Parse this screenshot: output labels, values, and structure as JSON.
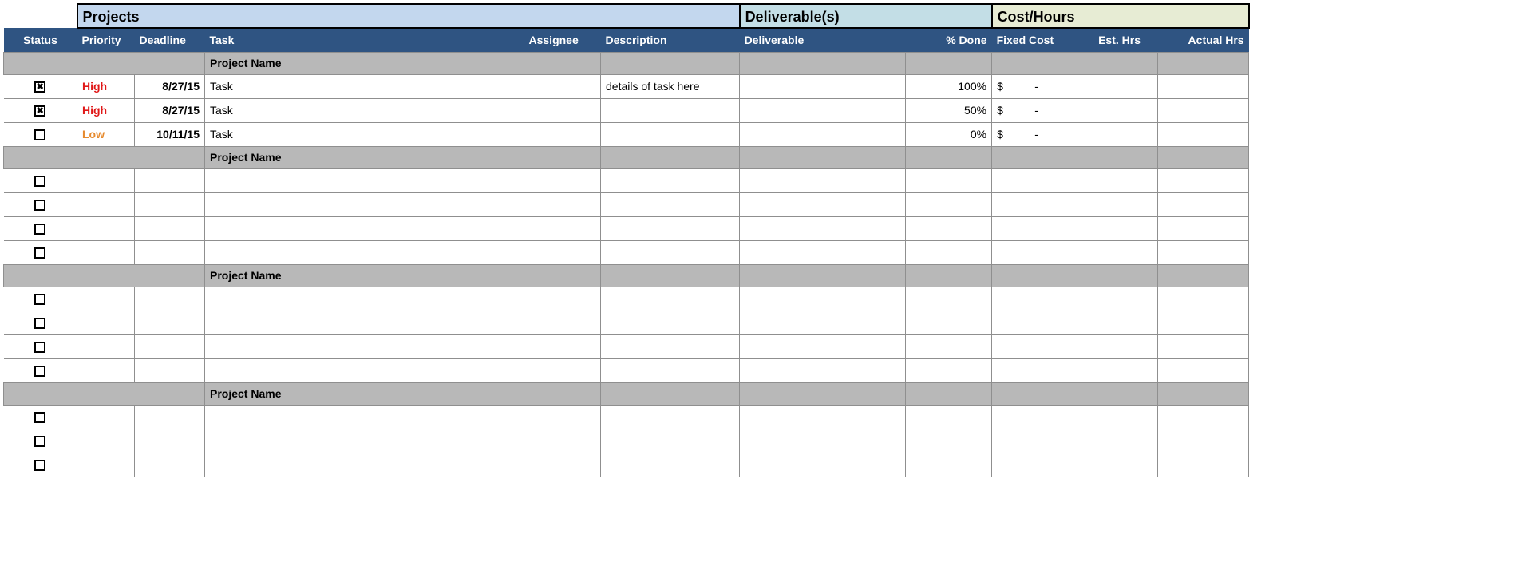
{
  "sections": {
    "projects": "Projects",
    "deliverables": "Deliverable(s)",
    "cost_hours": "Cost/Hours"
  },
  "columns": {
    "status": "Status",
    "priority": "Priority",
    "deadline": "Deadline",
    "task": "Task",
    "assignee": "Assignee",
    "description": "Description",
    "deliverable": "Deliverable",
    "pct_done": "% Done",
    "fixed_cost": "Fixed Cost",
    "est_hrs": "Est. Hrs",
    "actual_hrs": "Actual Hrs"
  },
  "groups": [
    {
      "name": "Project Name",
      "rows": [
        {
          "checked": true,
          "priority": "High",
          "priority_class": "prio-high",
          "deadline": "8/27/15",
          "task": "Task",
          "assignee": "",
          "description": "details of task here",
          "deliverable": "",
          "pct_done": "100%",
          "cost_sym": "$",
          "cost_val": "-",
          "est": "",
          "act": ""
        },
        {
          "checked": true,
          "priority": "High",
          "priority_class": "prio-high",
          "deadline": "8/27/15",
          "task": "Task",
          "assignee": "",
          "description": "",
          "deliverable": "",
          "pct_done": "50%",
          "cost_sym": "$",
          "cost_val": "-",
          "est": "",
          "act": ""
        },
        {
          "checked": false,
          "priority": "Low",
          "priority_class": "prio-low",
          "deadline": "10/11/15",
          "task": "Task",
          "assignee": "",
          "description": "",
          "deliverable": "",
          "pct_done": "0%",
          "cost_sym": "$",
          "cost_val": "-",
          "est": "",
          "act": ""
        }
      ]
    },
    {
      "name": "Project Name",
      "rows": [
        {
          "checked": false,
          "priority": "",
          "priority_class": "",
          "deadline": "",
          "task": "",
          "assignee": "",
          "description": "",
          "deliverable": "",
          "pct_done": "",
          "cost_sym": "",
          "cost_val": "",
          "est": "",
          "act": ""
        },
        {
          "checked": false,
          "priority": "",
          "priority_class": "",
          "deadline": "",
          "task": "",
          "assignee": "",
          "description": "",
          "deliverable": "",
          "pct_done": "",
          "cost_sym": "",
          "cost_val": "",
          "est": "",
          "act": ""
        },
        {
          "checked": false,
          "priority": "",
          "priority_class": "",
          "deadline": "",
          "task": "",
          "assignee": "",
          "description": "",
          "deliverable": "",
          "pct_done": "",
          "cost_sym": "",
          "cost_val": "",
          "est": "",
          "act": ""
        },
        {
          "checked": false,
          "priority": "",
          "priority_class": "",
          "deadline": "",
          "task": "",
          "assignee": "",
          "description": "",
          "deliverable": "",
          "pct_done": "",
          "cost_sym": "",
          "cost_val": "",
          "est": "",
          "act": ""
        }
      ]
    },
    {
      "name": "Project Name",
      "rows": [
        {
          "checked": false,
          "priority": "",
          "priority_class": "",
          "deadline": "",
          "task": "",
          "assignee": "",
          "description": "",
          "deliverable": "",
          "pct_done": "",
          "cost_sym": "",
          "cost_val": "",
          "est": "",
          "act": ""
        },
        {
          "checked": false,
          "priority": "",
          "priority_class": "",
          "deadline": "",
          "task": "",
          "assignee": "",
          "description": "",
          "deliverable": "",
          "pct_done": "",
          "cost_sym": "",
          "cost_val": "",
          "est": "",
          "act": ""
        },
        {
          "checked": false,
          "priority": "",
          "priority_class": "",
          "deadline": "",
          "task": "",
          "assignee": "",
          "description": "",
          "deliverable": "",
          "pct_done": "",
          "cost_sym": "",
          "cost_val": "",
          "est": "",
          "act": ""
        },
        {
          "checked": false,
          "priority": "",
          "priority_class": "",
          "deadline": "",
          "task": "",
          "assignee": "",
          "description": "",
          "deliverable": "",
          "pct_done": "",
          "cost_sym": "",
          "cost_val": "",
          "est": "",
          "act": ""
        }
      ]
    },
    {
      "name": "Project Name",
      "rows": [
        {
          "checked": false,
          "priority": "",
          "priority_class": "",
          "deadline": "",
          "task": "",
          "assignee": "",
          "description": "",
          "deliverable": "",
          "pct_done": "",
          "cost_sym": "",
          "cost_val": "",
          "est": "",
          "act": ""
        },
        {
          "checked": false,
          "priority": "",
          "priority_class": "",
          "deadline": "",
          "task": "",
          "assignee": "",
          "description": "",
          "deliverable": "",
          "pct_done": "",
          "cost_sym": "",
          "cost_val": "",
          "est": "",
          "act": ""
        },
        {
          "checked": false,
          "priority": "",
          "priority_class": "",
          "deadline": "",
          "task": "",
          "assignee": "",
          "description": "",
          "deliverable": "",
          "pct_done": "",
          "cost_sym": "",
          "cost_val": "",
          "est": "",
          "act": ""
        }
      ]
    }
  ],
  "checkbox_glyphs": {
    "checked": "✖",
    "unchecked": ""
  }
}
